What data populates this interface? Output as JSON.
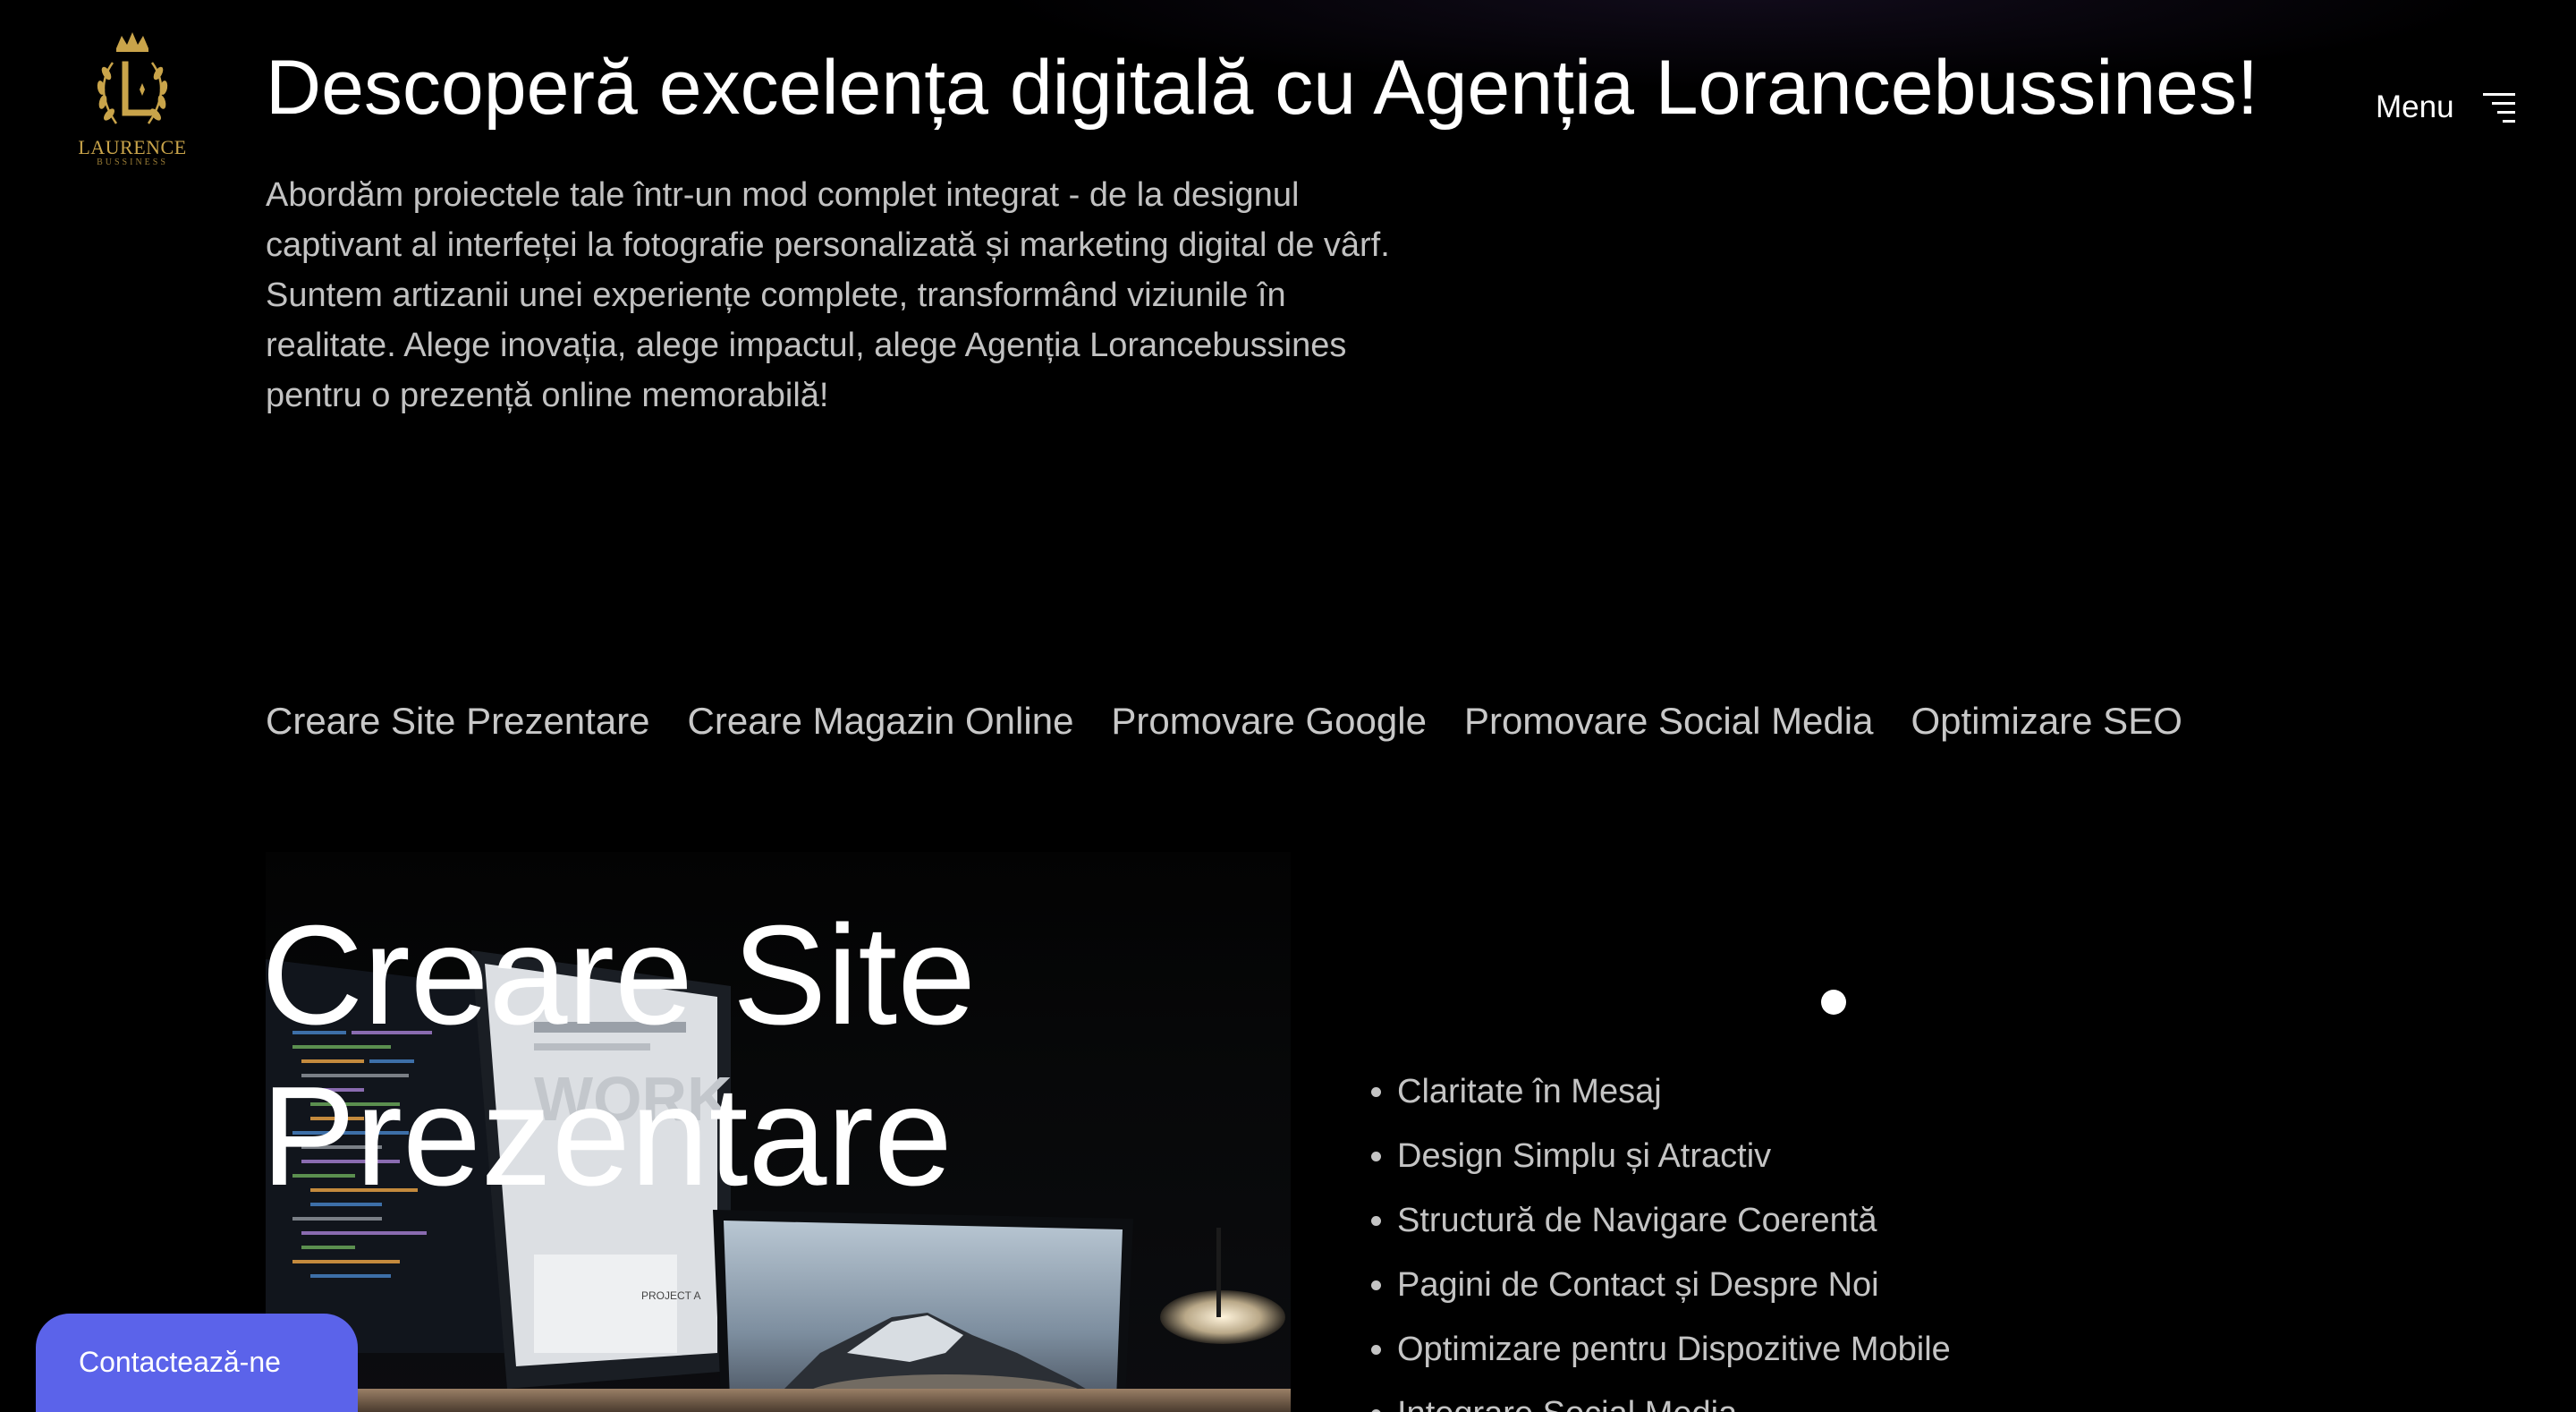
{
  "logo": {
    "brand_text": "LAURENCE",
    "sub_text": "BUSSINESS",
    "accent_color": "#c9a44a"
  },
  "header": {
    "title": "Descoperă excelența digitală cu Agenția Lorancebussines!",
    "menu_label": "Menu",
    "menu_icon": "hamburger-icon"
  },
  "hero": {
    "description": "Abordăm proiectele tale într-un mod complet integrat - de la designul captivant al interfeței la fotografie personalizată și marketing digital de vârf. Suntem artizanii unei experiențe complete, transformând viziunile în realitate. Alege inovația, alege impactul, alege Agenția Lorancebussines pentru o prezență online memorabilă!"
  },
  "services_nav": [
    {
      "label": "Creare Site Prezentare"
    },
    {
      "label": "Creare Magazin Online"
    },
    {
      "label": "Promovare Google"
    },
    {
      "label": "Promovare Social Media"
    },
    {
      "label": "Optimizare SEO"
    }
  ],
  "section": {
    "title_line1": "Creare Site",
    "title_line2": "Prezentare",
    "photo_screen_text": "WORK",
    "photo_card_text": "PROJECT A",
    "features": [
      "Claritate în Mesaj",
      "Design Simplu și Atractiv",
      "Structură de Navigare Coerentă",
      "Pagini de Contact și Despre Noi",
      "Optimizare pentru Dispozitive Mobile",
      "Integrare Social Media"
    ]
  },
  "contact_button": {
    "label": "Contactează-ne",
    "color": "#5b63ea"
  }
}
